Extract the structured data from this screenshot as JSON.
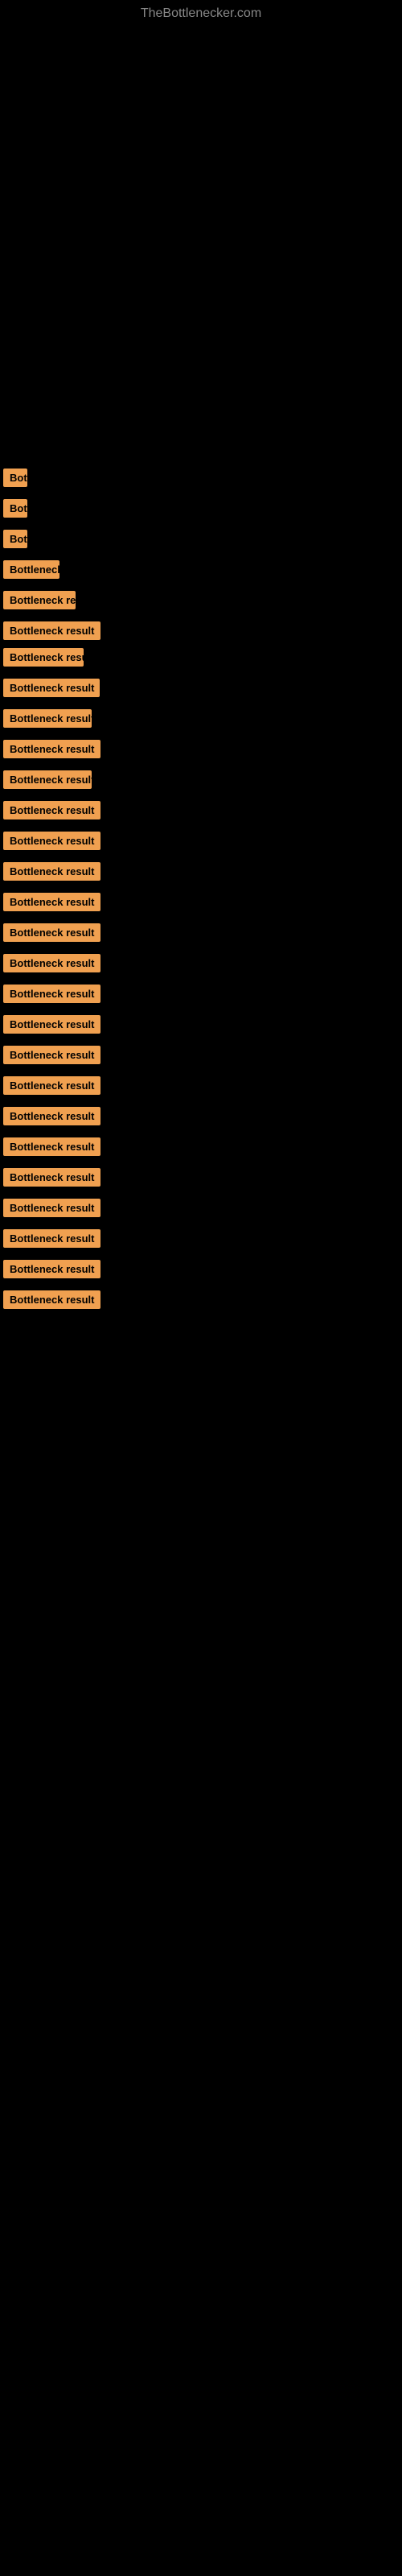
{
  "site": {
    "title": "TheBottlenecker.com"
  },
  "items": [
    {
      "id": 1,
      "label": "Bottleneck result",
      "width_class": "w-30",
      "display": "Bo"
    },
    {
      "id": 2,
      "label": "Bottleneck result",
      "width_class": "w-30",
      "display": "Bo"
    },
    {
      "id": 3,
      "label": "Bottleneck result",
      "width_class": "w-30",
      "display": "Bo"
    },
    {
      "id": 4,
      "label": "Bottleneck result",
      "width_class": "w-70",
      "display": "Bottlene"
    },
    {
      "id": 5,
      "label": "Bottleneck result",
      "width_class": "w-90",
      "display": "Bottleneck r"
    },
    {
      "id": 6,
      "label": "Bottleneck result",
      "width_class": "w-80",
      "display": "Bottleneck"
    },
    {
      "id": 7,
      "label": "Bottleneck result",
      "width_class": "w-100",
      "display": "Bottleneck res"
    },
    {
      "id": 8,
      "label": "Bottleneck result",
      "width_class": "w-120",
      "display": "Bottleneck result"
    },
    {
      "id": 9,
      "label": "Bottleneck result",
      "width_class": "w-110",
      "display": "Bottleneck res"
    },
    {
      "id": 10,
      "label": "Bottleneck result",
      "width_class": "w-120",
      "display": "Bottleneck resul"
    },
    {
      "id": 11,
      "label": "Bottleneck result",
      "width_class": "w-100",
      "display": "Bottleneck r"
    },
    {
      "id": 12,
      "label": "Bottleneck result",
      "width_class": "w-130",
      "display": "Bottleneck result"
    },
    {
      "id": 13,
      "label": "Bottleneck result",
      "width_class": "w-110",
      "display": "Bottleneck res"
    },
    {
      "id": 14,
      "label": "Bottleneck result",
      "width_class": "w-140",
      "display": "Bottleneck result"
    },
    {
      "id": 15,
      "label": "Bottleneck result",
      "width_class": "w-140",
      "display": "Bottleneck result"
    },
    {
      "id": 16,
      "label": "Bottleneck result",
      "width_class": "w-150",
      "display": "Bottleneck result"
    },
    {
      "id": 17,
      "label": "Bottleneck result",
      "width_class": "w-150",
      "display": "Bottleneck result"
    },
    {
      "id": 18,
      "label": "Bottleneck result",
      "width_class": "w-160",
      "display": "Bottleneck result"
    },
    {
      "id": 19,
      "label": "Bottleneck result",
      "width_class": "w-160",
      "display": "Bottleneck result"
    },
    {
      "id": 20,
      "label": "Bottleneck result",
      "width_class": "w-171",
      "display": "Bottleneck result"
    },
    {
      "id": 21,
      "label": "Bottleneck result",
      "width_class": "w-171",
      "display": "Bottleneck result"
    },
    {
      "id": 22,
      "label": "Bottleneck result",
      "width_class": "w-175",
      "display": "Bottleneck result"
    },
    {
      "id": 23,
      "label": "Bottleneck result",
      "width_class": "w-195",
      "display": "Bottleneck result"
    },
    {
      "id": 24,
      "label": "Bottleneck result",
      "width_class": "w-202",
      "display": "Bottleneck result"
    },
    {
      "id": 25,
      "label": "Bottleneck result",
      "width_class": "w-210",
      "display": "Bottleneck result"
    },
    {
      "id": 26,
      "label": "Bottleneck result",
      "width_class": "w-212",
      "display": "Bottleneck result"
    },
    {
      "id": 27,
      "label": "Bottleneck result",
      "width_class": "w-214",
      "display": "Bottleneck result"
    },
    {
      "id": 28,
      "label": "Bottleneck result",
      "width_class": "w-205",
      "display": "Bottleneck result"
    }
  ]
}
